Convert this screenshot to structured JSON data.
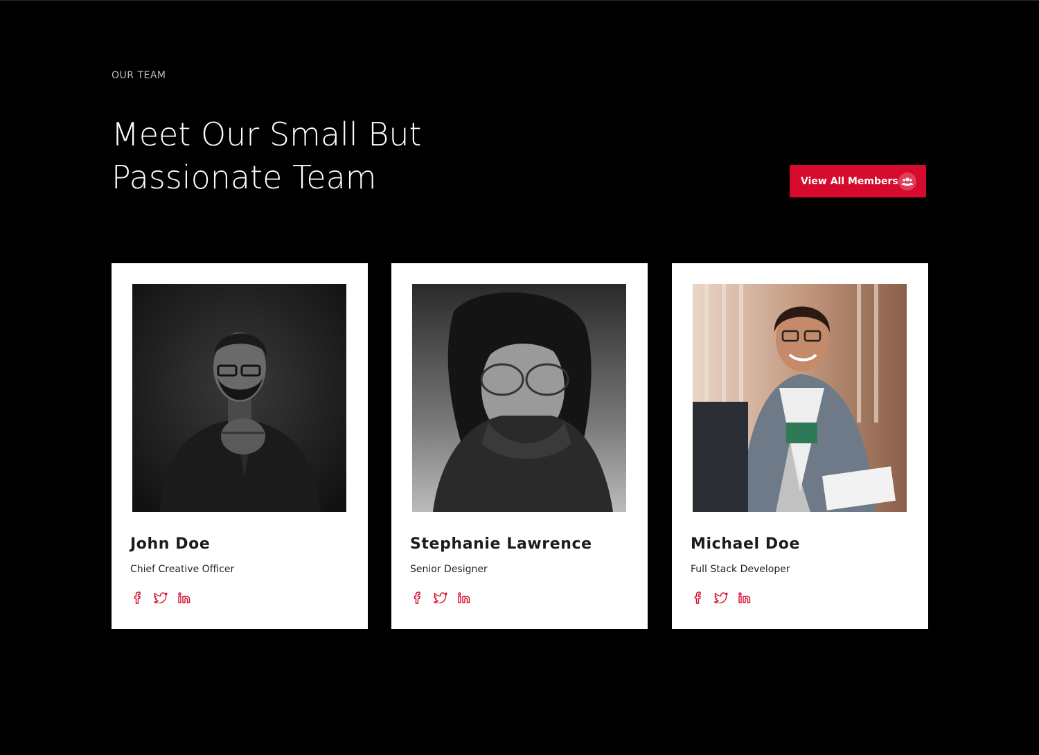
{
  "section": {
    "eyebrow": "OUR TEAM",
    "headline_line1": "Meet Our Small But",
    "headline_line2": "Passionate Team",
    "view_all_label": "View All Members"
  },
  "colors": {
    "background": "#000000",
    "accent": "#d50a2c",
    "card": "#ffffff"
  },
  "members": [
    {
      "name": "John Doe",
      "role": "Chief Creative Officer",
      "photo_icon": "portrait-man-glasses-bw"
    },
    {
      "name": "Stephanie Lawrence",
      "role": "Senior Designer",
      "photo_icon": "portrait-woman-glasses-bw"
    },
    {
      "name": "Michael Doe",
      "role": "Full Stack Developer",
      "photo_icon": "portrait-man-denim-jacket-color"
    }
  ],
  "social_icons": [
    "facebook-icon",
    "twitter-icon",
    "linkedin-icon"
  ]
}
